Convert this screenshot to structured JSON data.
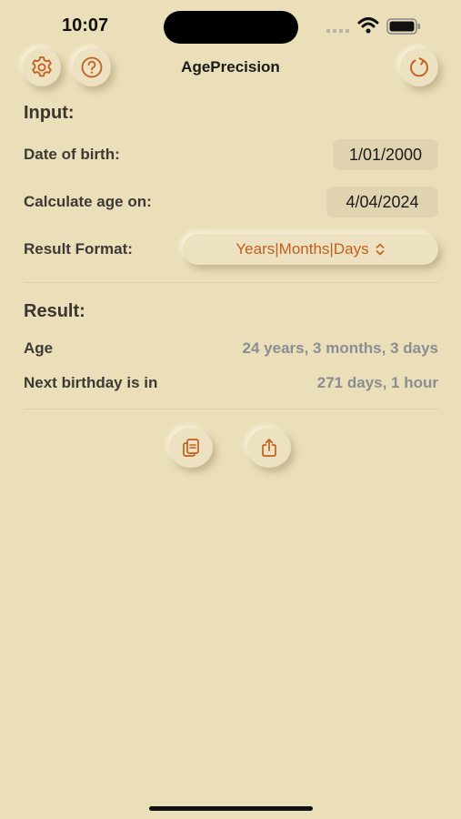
{
  "status_bar": {
    "time": "10:07"
  },
  "header": {
    "title": "AgePrecision",
    "icons": {
      "settings": "gear-icon",
      "help": "question-icon",
      "reset": "refresh-icon"
    }
  },
  "input": {
    "section_title": "Input:",
    "dob_label": "Date of birth:",
    "dob_value": "1/01/2000",
    "calc_label": "Calculate age on:",
    "calc_value": "4/04/2024",
    "format_label": "Result Format:",
    "format_value": "Years|Months|Days"
  },
  "result": {
    "section_title": "Result:",
    "age_label": "Age",
    "age_value": "24 years, 3 months, 3 days",
    "next_label": "Next birthday is in",
    "next_value": "271 days, 1 hour"
  },
  "actions": {
    "copy": "copy-icon",
    "share": "share-icon"
  },
  "colors": {
    "background": "#eadfb9",
    "accent": "#c25e1e",
    "muted_value": "#8c8c94"
  }
}
